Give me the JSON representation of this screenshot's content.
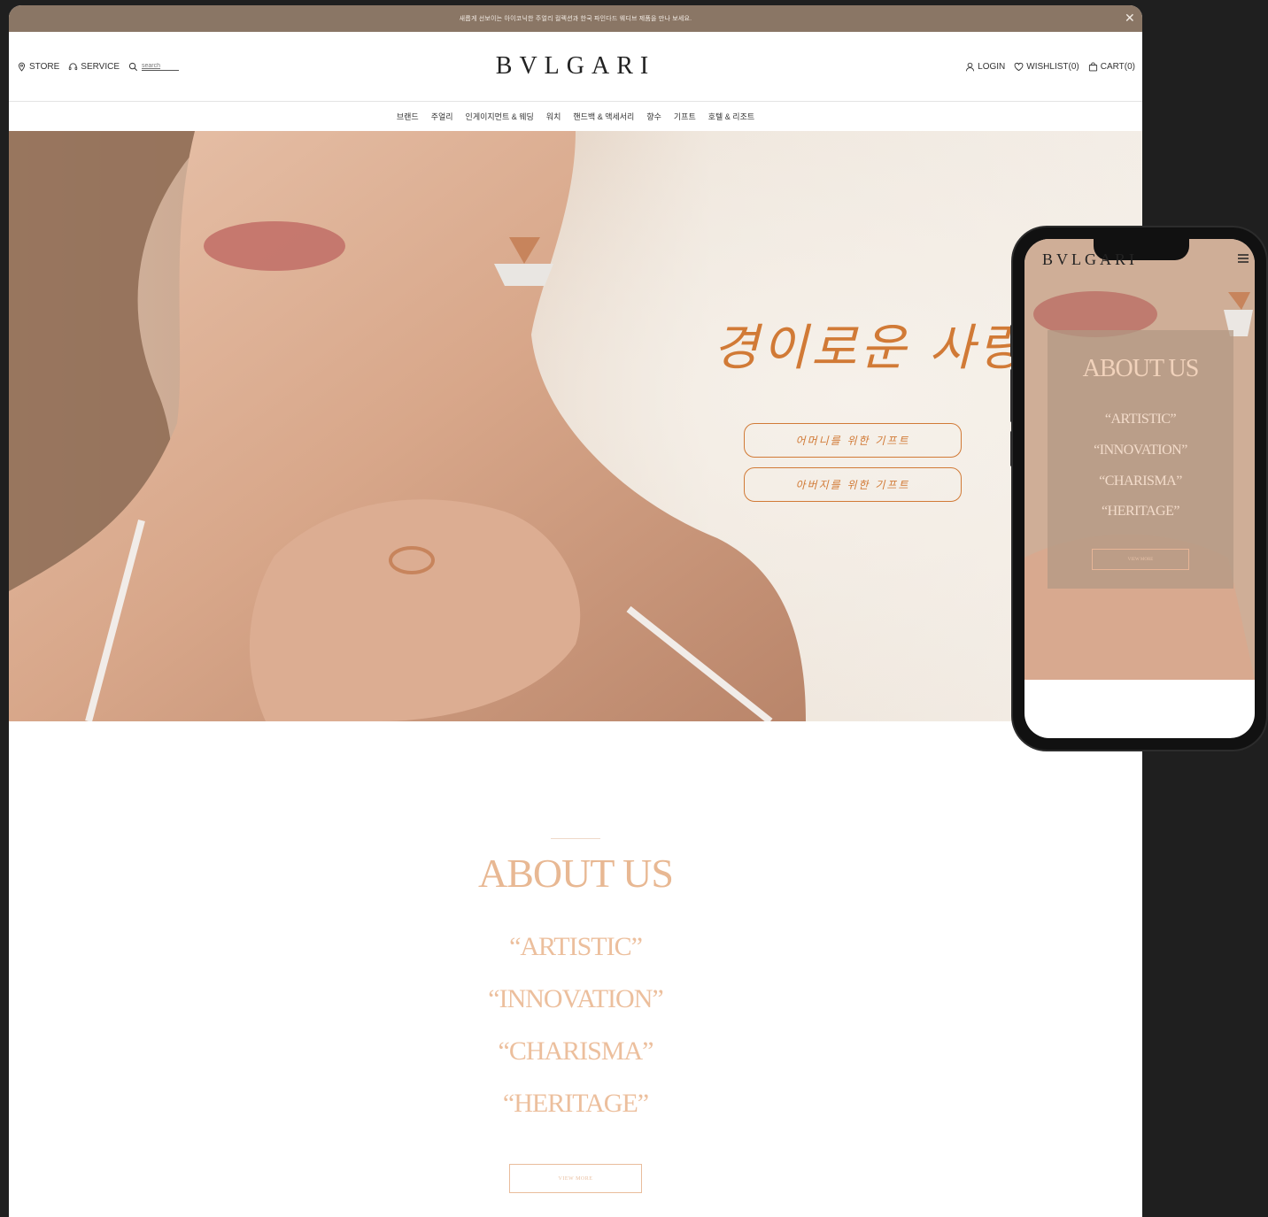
{
  "announcement": {
    "text": "새롭게 선보이는 아이코닉한 주얼리 컬렉션과 한국 파인다드 웨디브 제품을 만나 보세요."
  },
  "header": {
    "store_label": "STORE",
    "service_label": "SERVICE",
    "search_placeholder": "search",
    "logo": "BVLGARI",
    "login_label": "LOGIN",
    "wishlist_label": "WISHLIST(0)",
    "cart_label": "CART(0)"
  },
  "nav": {
    "items": [
      "브랜드",
      "주얼리",
      "인게이지먼트 & 웨딩",
      "워치",
      "핸드백 & 액세서리",
      "향수",
      "기프트",
      "호텔 & 리조트"
    ]
  },
  "hero": {
    "title": "경이로운 사랑",
    "buttons": [
      "어머니를 위한 기프트",
      "아버지를 위한 기프트"
    ]
  },
  "about": {
    "title": "ABOUT US",
    "words": [
      "“ARTISTIC”",
      "“INNOVATION”",
      "“CHARISMA”",
      "“HERITAGE”"
    ],
    "view_more": "VIEW MORE"
  },
  "mobile": {
    "logo": "BVLGARI",
    "about_title": "ABOUT US",
    "words": [
      "“ARTISTIC”",
      "“INNOVATION”",
      "“CHARISMA”",
      "“HERITAGE”"
    ],
    "view_more": "VIEW MORE"
  },
  "icons": {
    "location": "location-pin-icon",
    "service": "headset-icon",
    "search": "search-icon",
    "user": "user-icon",
    "wishlist": "heart-icon",
    "cart": "shopping-bag-icon",
    "close": "close-icon",
    "menu": "hamburger-menu-icon"
  },
  "colors": {
    "announcement_bg": "#8a7665",
    "accent_orange": "#d17a36",
    "about_peach": "#e8b893",
    "page_bg": "#1f1f1f"
  }
}
